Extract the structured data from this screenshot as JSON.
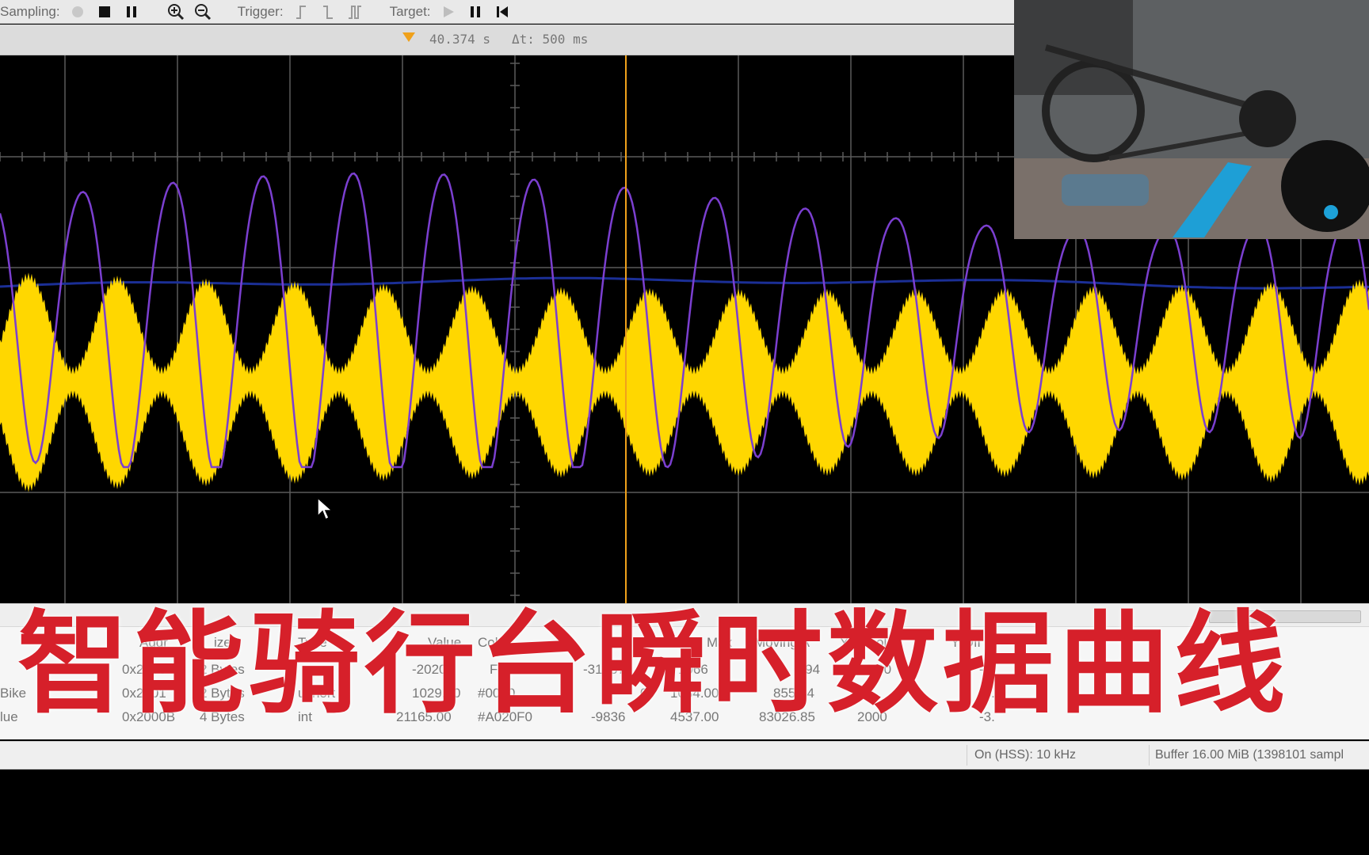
{
  "toolbar": {
    "sampling_label": "Sampling:",
    "trigger_label": "Trigger:",
    "target_label": "Target:",
    "icons": [
      "record-icon",
      "stop-icon",
      "pause-icon",
      "zoom-in-icon",
      "zoom-out-icon",
      "trigger-rising-icon",
      "trigger-falling-icon",
      "trigger-both-icon",
      "play-icon",
      "pause-icon",
      "skip-start-icon"
    ]
  },
  "cursor": {
    "time": "40.374 s",
    "delta": "Δt: 500 ms",
    "color": "#f0a11b"
  },
  "scope": {
    "grid_color": "#5a5a5a",
    "purple_color": "#7b3fd0",
    "yellow_color": "#ffd700",
    "blue_color": "#1b2f96"
  },
  "table": {
    "headers": [
      "Addr",
      "ize",
      "Type",
      "Value",
      "Color",
      "Min",
      "Max",
      "Moving A",
      "Y Resol",
      "Y Off"
    ],
    "rows": [
      [
        "",
        "0x2000",
        "2 Bytes",
        "",
        "-20202",
        "FFD700",
        "-31857",
        "1066",
        "1.94",
        "0.00",
        "-2."
      ],
      [
        "Bike",
        "0x2001",
        "2 Bytes",
        "ushort",
        "1029.00",
        "#0000",
        "0",
        "1034.00",
        "855.84",
        "",
        "-3."
      ],
      [
        "lue",
        "0x2000B",
        "4 Bytes",
        "int",
        "21165.00",
        "#A020F0",
        "-9836",
        "4537.00",
        "83026.85",
        "2000",
        "-3."
      ]
    ]
  },
  "status": {
    "sampling_rate": "On (HSS): 10 kHz",
    "buffer": "Buffer 16.00 MiB (1398101 sampl"
  },
  "caption": "智能骑行台瞬时数据曲线"
}
